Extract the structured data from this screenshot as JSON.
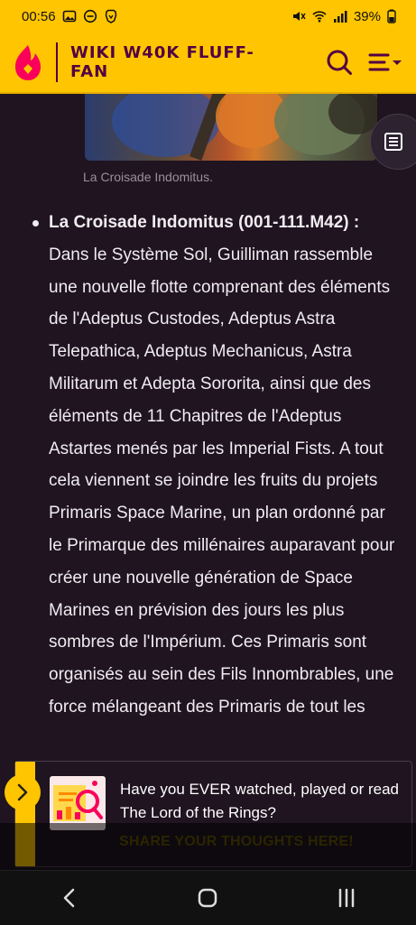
{
  "status_bar": {
    "time": "00:56",
    "battery": "39%",
    "icons": [
      "image-icon",
      "do-not-disturb-icon",
      "brave-icon",
      "mute-icon",
      "wifi-icon",
      "signal-icon",
      "battery-icon"
    ]
  },
  "header": {
    "site_title": "WIKI W40K FLUFF-FAN",
    "icons": [
      "fandom-logo-icon",
      "search-icon",
      "menu-icon"
    ]
  },
  "article": {
    "image_caption": "La Croisade Indomitus.",
    "bullet_title": "La Croisade Indomitus (001-111.M42) :",
    "body_text": "Dans le Système Sol, Guilliman rassemble une nouvelle flotte comprenant des éléments de l'Adeptus Custodes, Adeptus Astra Telepathica, Adeptus Mechanicus, Astra Militarum et Adepta Sororita, ainsi que des éléments de 11 Chapitres de l'Adeptus Astartes menés par les Imperial Fists. A tout cela viennent se joindre les fruits du projets Primaris Space Marine, un plan ordonné par le Primarque des millénaires auparavant pour créer une nouvelle génération de Space Marines en prévision des jours les plus sombres de l'Impérium. Ces Primaris sont organisés au sein des Fils Innombrables, une force mélangeant des Primaris de tout les"
  },
  "promo": {
    "text": "Have you EVER watched, played or read The Lord of the Rings?",
    "cta": "SHARE YOUR THOUGHTS HERE!"
  },
  "colors": {
    "brand_yellow": "#ffc500",
    "brand_purple": "#520044",
    "background": "#1f1420"
  }
}
